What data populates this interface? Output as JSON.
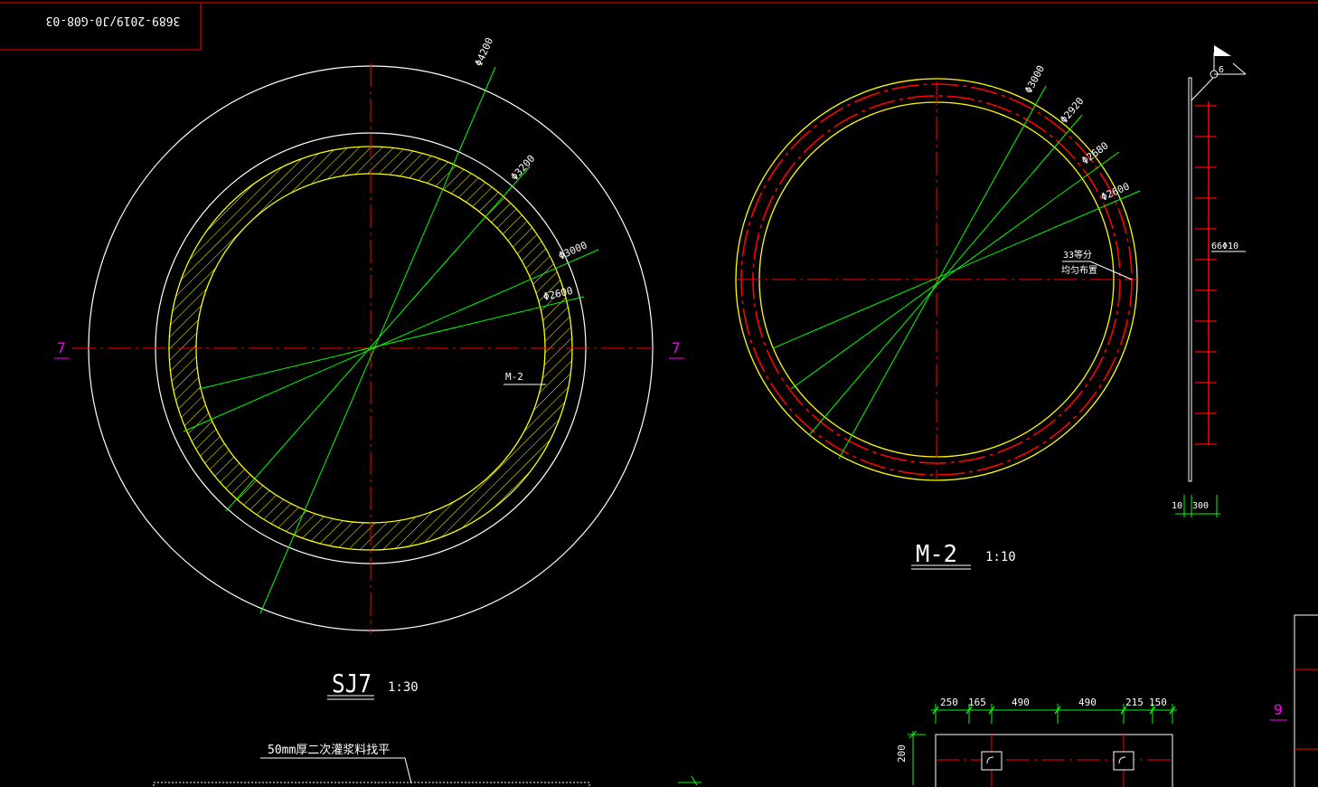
{
  "title_block": {
    "drawing_number": "3689-2019/J0-G08-03"
  },
  "sj7": {
    "title": "SJ7",
    "scale": "1:30",
    "diameters": [
      "Φ4200",
      "Φ3200",
      "Φ3000",
      "Φ2600"
    ],
    "section_mark": "7",
    "component_ref": "M-2"
  },
  "m2": {
    "title": "M-2",
    "scale": "1:10",
    "diameters": [
      "Φ3000",
      "Φ2920",
      "Φ2680",
      "Φ2600"
    ],
    "bar_note_line1": "33等分",
    "bar_note_line2": "均匀布置",
    "side_detail_flag": "6",
    "side_detail_rebar": "66Φ10",
    "side_dim_left": "10",
    "side_dim_right": "300"
  },
  "grout_note": "50mm厚二次灌浆料找平",
  "foundation": {
    "dimensions": [
      "250",
      "165",
      "490",
      "490",
      "215",
      "150"
    ],
    "height": "200"
  },
  "section_mark_right": "9",
  "colors": {
    "background": "#000000",
    "outline": "#ffffff",
    "wall": "#ffff00",
    "centerline": "#ff0000",
    "leader": "#00ff00",
    "section_label": "#ff00ff"
  }
}
